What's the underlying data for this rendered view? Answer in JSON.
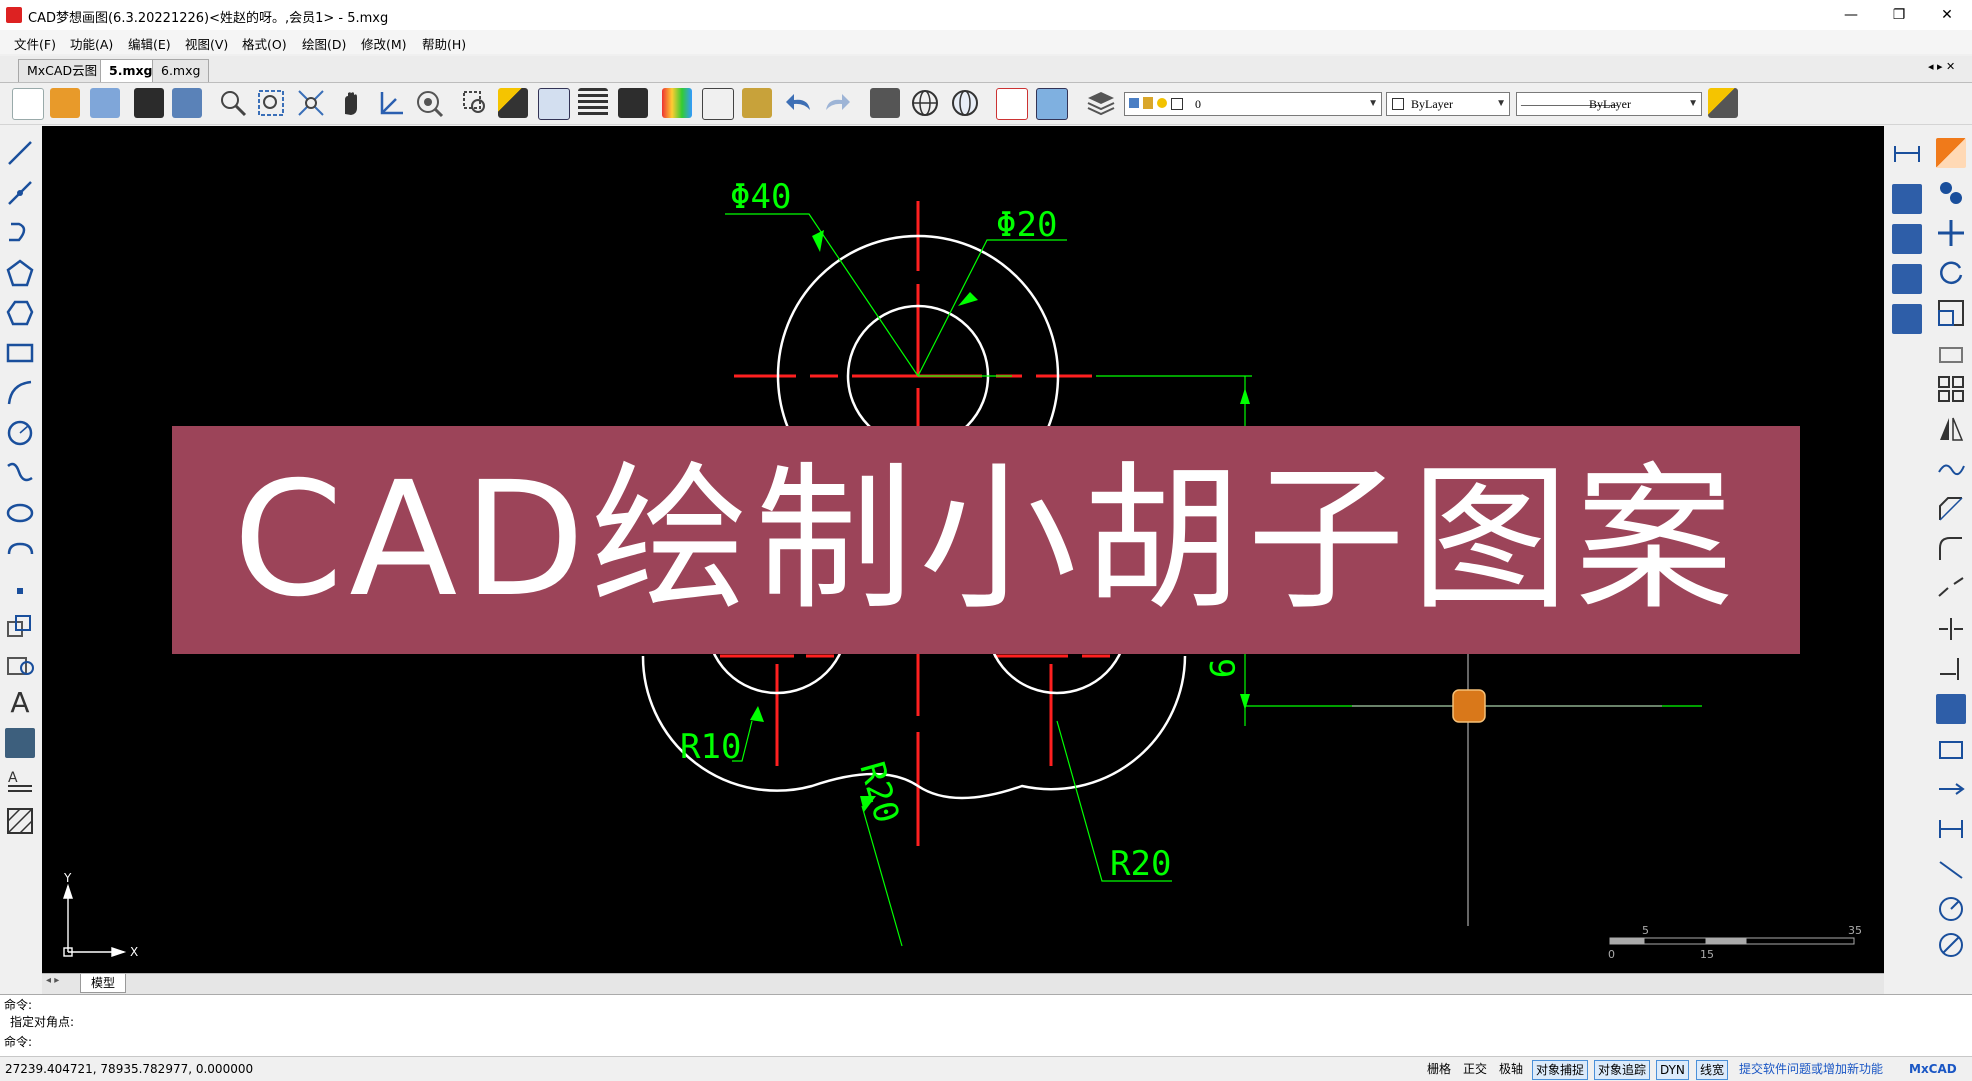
{
  "window": {
    "title": "CAD梦想画图(6.3.20221226)<姓赵的呀。,会员1> - 5.mxg",
    "controls": {
      "minimize": "—",
      "restore": "❐",
      "close": "✕"
    }
  },
  "menu": [
    "文件(F)",
    "功能(A)",
    "编辑(E)",
    "视图(V)",
    "格式(O)",
    "绘图(D)",
    "修改(M)",
    "帮助(H)"
  ],
  "tabs": [
    {
      "label": "MxCAD云图",
      "active": false
    },
    {
      "label": "5.mxg",
      "active": true
    },
    {
      "label": "6.mxg",
      "active": false
    }
  ],
  "tab_nav": "◂ ▸ ✕",
  "toolbar": {
    "layer_value": "0",
    "color_value": "ByLayer",
    "linetype_value": "ByLayer",
    "linetype_sample": "————————"
  },
  "drawing": {
    "labels": {
      "phi40": "Φ40",
      "phi20": "Φ20",
      "r10": "R10",
      "r20_left": "R20",
      "r20_right": "R20",
      "dim9": "9"
    },
    "scale": {
      "t5": "5",
      "t35": "35",
      "t0": "0",
      "t15": "15"
    },
    "ucs": {
      "y": "Y",
      "x": "X"
    },
    "colors": {
      "geometry": "#ffffff",
      "center": "#ff2020",
      "dimension": "#00ff00",
      "grip": "#d9781a"
    }
  },
  "banner": {
    "text": "CAD绘制小胡子图案",
    "color": "#9c4459"
  },
  "model_tab": "模型",
  "model_nav": "◂ ▸",
  "command": {
    "lines": [
      "命令:",
      "指定对角点:",
      "命令:"
    ]
  },
  "status": {
    "coordinates": "27239.404721,  78935.782977,  0.000000",
    "toggles": [
      {
        "label": "栅格",
        "on": false
      },
      {
        "label": "正交",
        "on": false
      },
      {
        "label": "极轴",
        "on": false
      },
      {
        "label": "对象捕捉",
        "on": true
      },
      {
        "label": "对象追踪",
        "on": true
      },
      {
        "label": "DYN",
        "on": true
      },
      {
        "label": "线宽",
        "on": true
      }
    ],
    "feedback": "提交软件问题或增加新功能",
    "brand": "MxCAD"
  }
}
